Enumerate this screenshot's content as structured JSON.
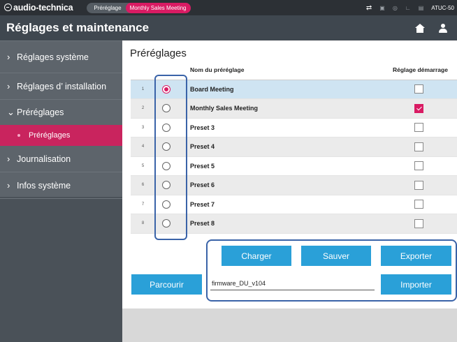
{
  "topbar": {
    "brand": "audio-technica",
    "preset_label": "Préréglage",
    "preset_value": "Monthly Sales Meeting",
    "model": "ATUC-50"
  },
  "header": {
    "title": "Réglages et maintenance"
  },
  "sidebar": {
    "items": [
      {
        "label": "Réglages système"
      },
      {
        "label": "Réglages d’ installation"
      },
      {
        "label": "Préréglages"
      },
      {
        "label": "Préréglages"
      },
      {
        "label": "Journalisation"
      },
      {
        "label": "Infos système"
      }
    ]
  },
  "main": {
    "title": "Préréglages",
    "columns": {
      "name": "Nom du préréglage",
      "startup": "Réglage démarrage"
    },
    "rows": [
      {
        "num": "1",
        "name": "Board Meeting",
        "selected": true,
        "startup": false
      },
      {
        "num": "2",
        "name": "Monthly Sales Meeting",
        "selected": false,
        "startup": true
      },
      {
        "num": "3",
        "name": "Preset 3",
        "selected": false,
        "startup": false
      },
      {
        "num": "4",
        "name": "Preset 4",
        "selected": false,
        "startup": false
      },
      {
        "num": "5",
        "name": "Preset 5",
        "selected": false,
        "startup": false
      },
      {
        "num": "6",
        "name": "Preset 6",
        "selected": false,
        "startup": false
      },
      {
        "num": "7",
        "name": "Preset 7",
        "selected": false,
        "startup": false
      },
      {
        "num": "8",
        "name": "Preset 8",
        "selected": false,
        "startup": false
      }
    ],
    "buttons": {
      "load": "Charger",
      "save": "Sauver",
      "export": "Exporter",
      "browse": "Parcourir",
      "import": "Importer"
    },
    "file_field_value": "firmware_DU_v104"
  },
  "colors": {
    "accent": "#d91b63",
    "button": "#2aa0d8",
    "highlight_border": "#3a63a8"
  }
}
